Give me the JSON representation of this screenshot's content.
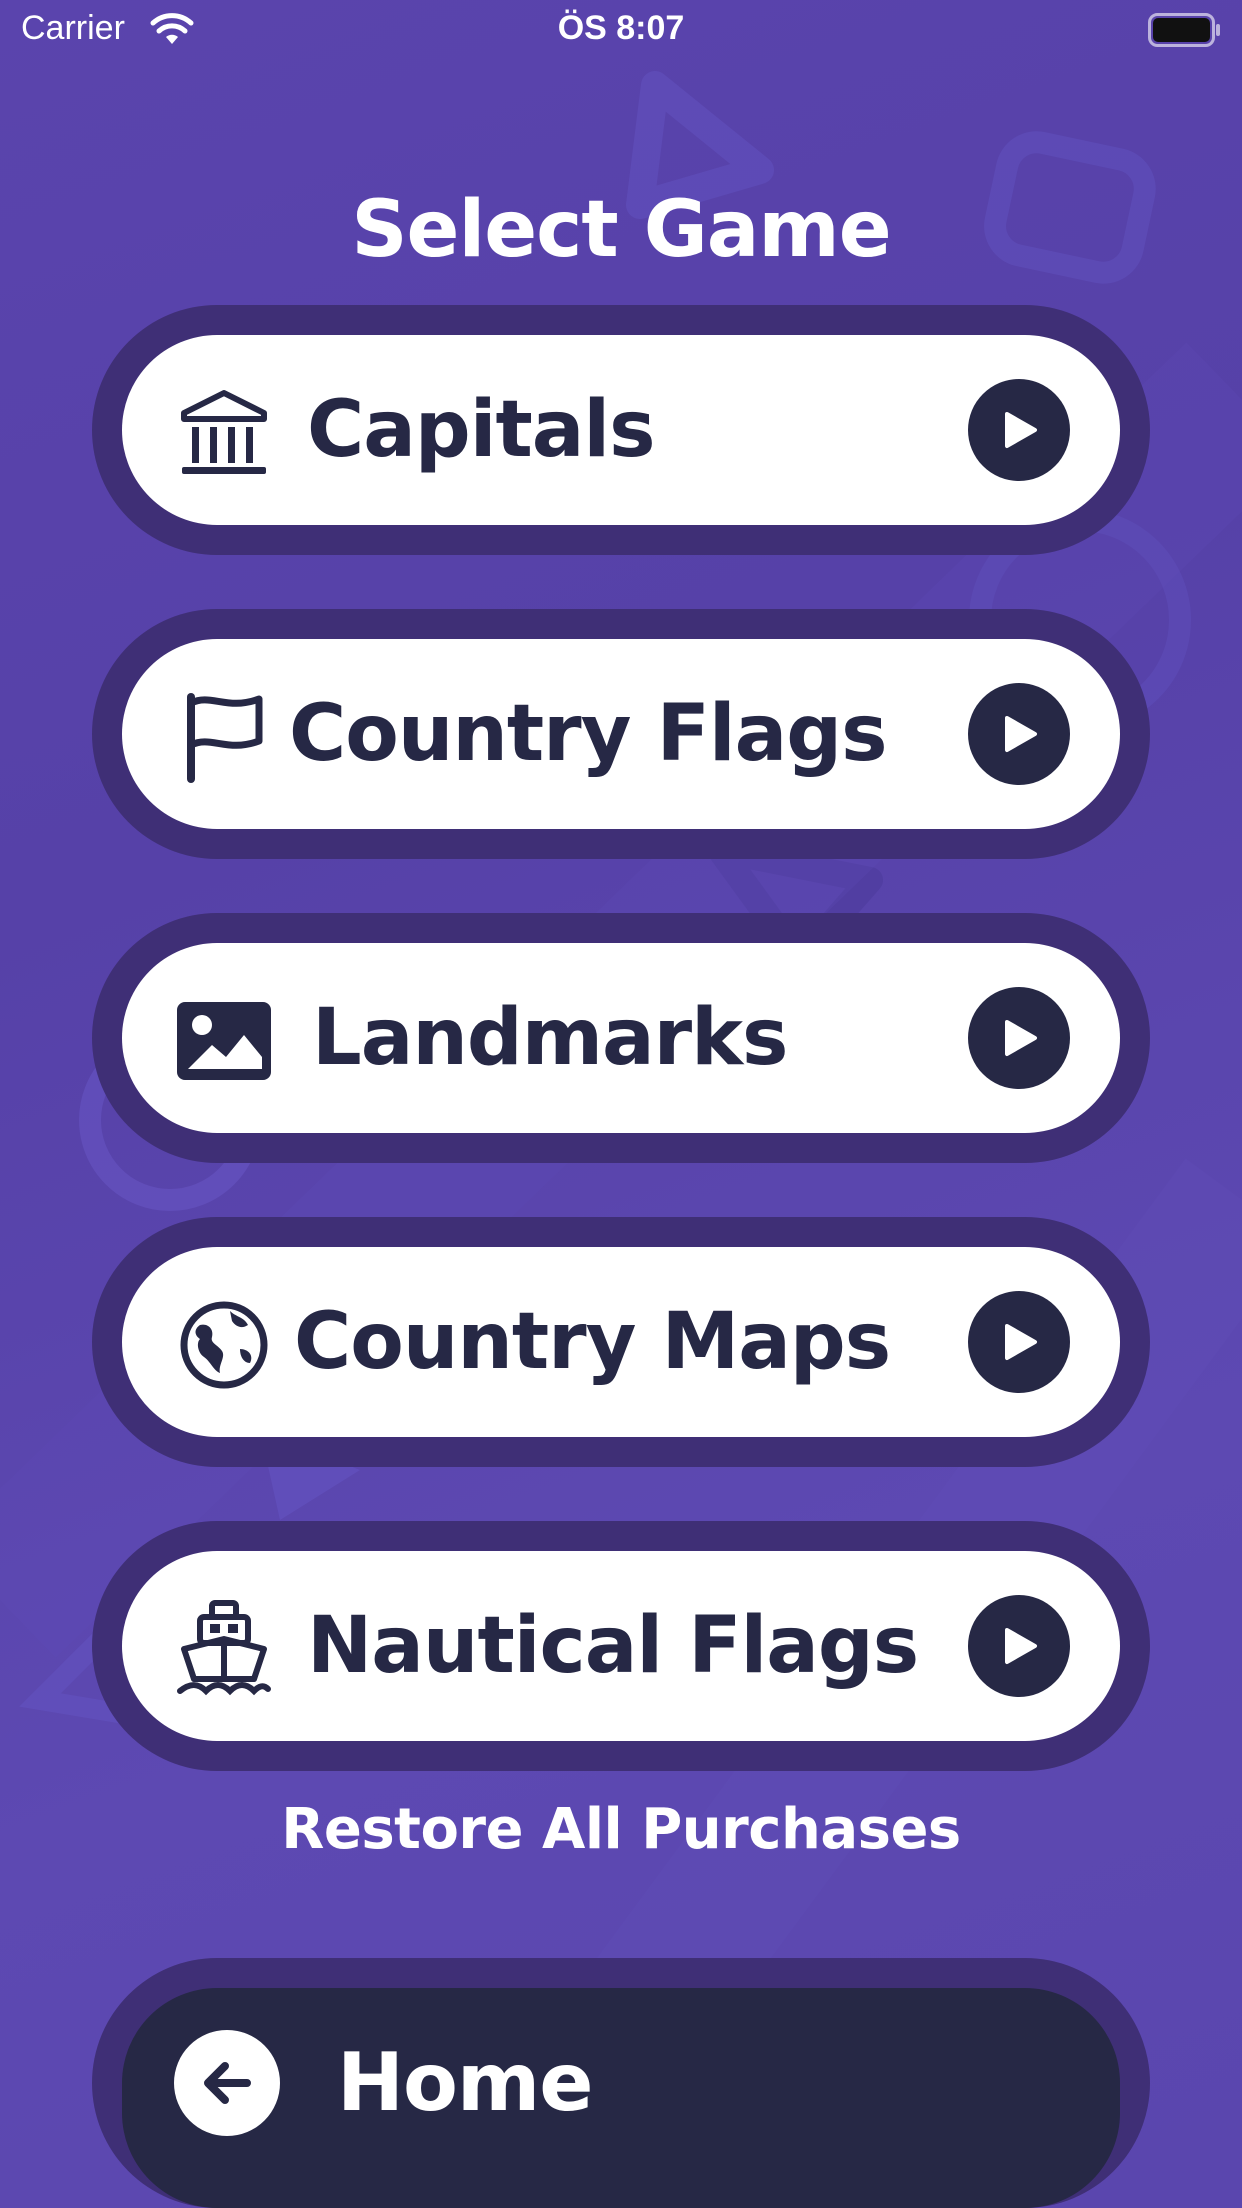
{
  "status_bar": {
    "carrier": "Carrier",
    "time": "ÖS 8:07"
  },
  "title": "Select Game",
  "games": [
    {
      "label": "Capitals",
      "icon": "bank-icon"
    },
    {
      "label": "Country Flags",
      "icon": "flag-icon"
    },
    {
      "label": "Landmarks",
      "icon": "image-icon"
    },
    {
      "label": "Country Maps",
      "icon": "globe-icon"
    },
    {
      "label": "Nautical Flags",
      "icon": "ship-icon"
    }
  ],
  "restore_label": "Restore All Purchases",
  "home_label": "Home",
  "colors": {
    "background": "#5a44ad",
    "button_ring": "#3f2f76",
    "dark": "#262845",
    "white": "#ffffff"
  }
}
